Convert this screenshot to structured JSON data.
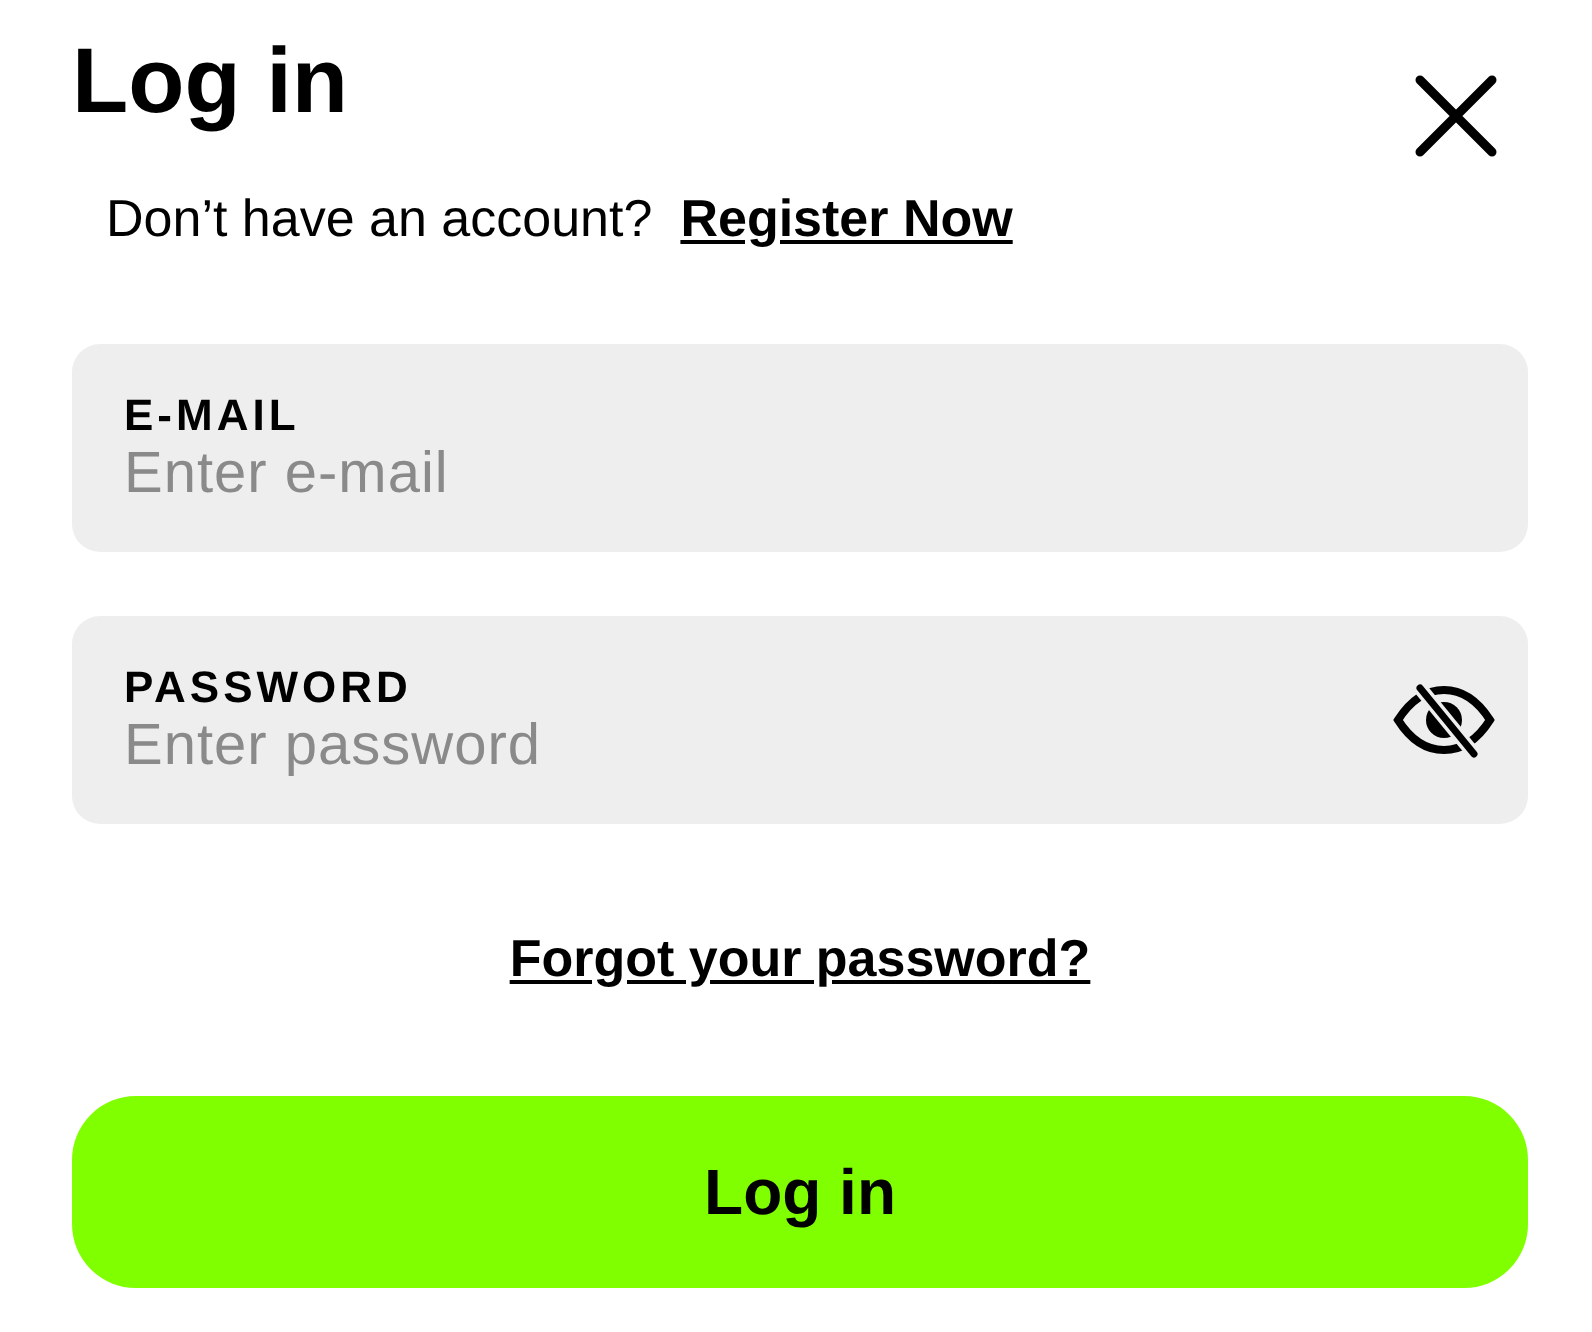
{
  "title": "Log in",
  "signup": {
    "prompt": "Don’t have an account?",
    "link": "Register Now"
  },
  "fields": [
    {
      "label": "E-MAIL",
      "placeholder": "Enter e-mail",
      "kind": "text"
    },
    {
      "label": "PASSWORD",
      "placeholder": "Enter password",
      "kind": "password"
    }
  ],
  "forgot_link": "Forgot your password?",
  "submit": "Log in"
}
